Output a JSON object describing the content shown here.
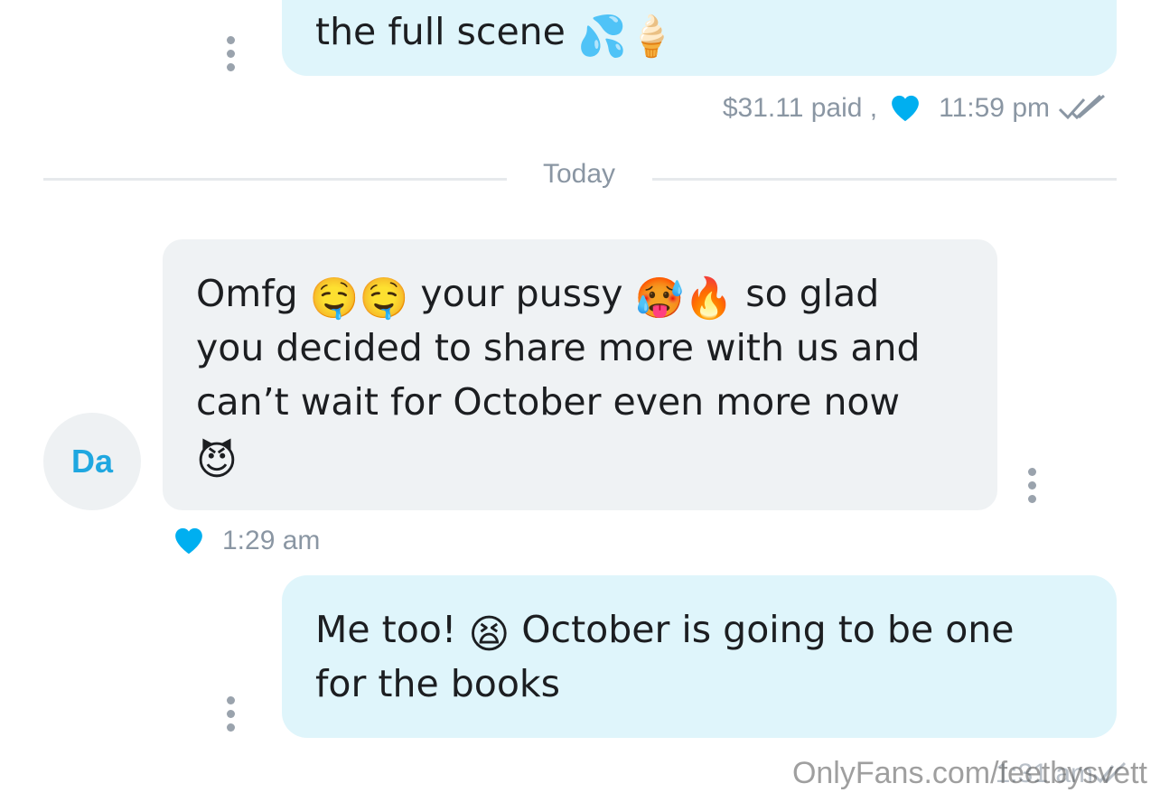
{
  "messages": {
    "top": {
      "text": "the full scene",
      "emojis": [
        "💦",
        "🍦"
      ],
      "price": "$31.11 paid ,",
      "time": "11:59 pm"
    },
    "divider_label": "Today",
    "incoming": {
      "avatar_initials": "Da",
      "line1_a": "Omfg",
      "line1_emoji_a": "🤤🤤",
      "line1_b": "your pussy",
      "line1_emoji_b": "🥵🔥",
      "line1_c": "so glad",
      "line2": "you decided to share more with us and",
      "line3": "can’t wait for October even more now",
      "line4_emoji": "😈",
      "time": "1:29 am"
    },
    "reply": {
      "part_a": "Me too!",
      "emoji": "😫",
      "part_b": "October is going to be one",
      "line2": "for the books",
      "time": "1:31 am"
    }
  },
  "watermark": "OnlyFans.com/feetbysvett",
  "colors": {
    "accent": "#00aff0",
    "outgoing_bubble": "#dff5fb",
    "incoming_bubble": "#eff2f4",
    "meta_text": "#8a96a3"
  },
  "icons": {
    "heart": "heart-icon",
    "read_receipt": "double-check-icon",
    "menu": "more-vertical-icon"
  }
}
